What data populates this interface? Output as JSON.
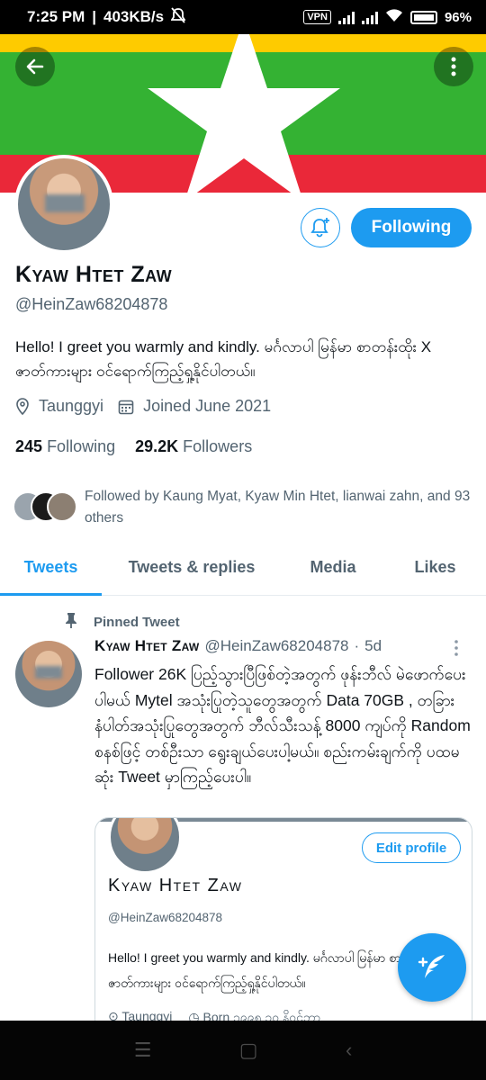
{
  "status_bar": {
    "time": "7:25 PM",
    "speed": "403KB/s",
    "vpn": "VPN",
    "battery": "96%"
  },
  "profile": {
    "name": "Kyaw Htet Zaw",
    "handle": "@HeinZaw68204878",
    "follow_button": "Following",
    "bio": "Hello! I greet you warmly and kindly.  မင်္ဂလာပါ မြန်မာ စာတန်းထိုး X ဇာတ်ကားများ ဝင်ရောက်ကြည့်ရှု့နိုင်ပါတယ်။",
    "location": "Taunggyi",
    "joined": "Joined June 2021",
    "following_count": "245",
    "following_label": "Following",
    "followers_count": "29.2K",
    "followers_label": "Followers",
    "followed_by": "Followed by Kaung Myat, Kyaw Min Htet, lianwai zahn, and 93 others"
  },
  "tabs": [
    {
      "label": "Tweets"
    },
    {
      "label": "Tweets & replies"
    },
    {
      "label": "Media"
    },
    {
      "label": "Likes"
    }
  ],
  "tweet": {
    "pinned_label": "Pinned Tweet",
    "author_name": "Kyaw Htet Zaw",
    "author_handle": "@HeinZaw68204878",
    "dot": "·",
    "time": "5d",
    "text": "Follower 26K ပြည့်သွားပြီဖြစ်တဲ့အတွက် ဖုန်းဘီလ် မဲဖောက်ပေးပါမယ် Mytel အသုံးပြုတဲ့သူတွေအတွက် Data 70GB , တခြားနံပါတ်အသုံးပြုတွေအတွက် ဘီလ်သီးသန့် 8000 ကျပ်ကို Random စနစ်ဖြင့် တစ်ဦးသာ ရွေးချယ်ပေးပါ့မယ်။ စည်းကမ်းချက်ကို ပထမဆုံး Tweet မှာကြည့်ပေးပါ။"
  },
  "quoted_card": {
    "edit_button": "Edit profile",
    "name": "Kyaw Htet Zaw",
    "handle": "@HeinZaw68204878",
    "bio": "Hello! I greet you warmly and kindly.  မင်္ဂလာပါ မြန်မာ စာတန်းထိုး X ဇာတ်ကားများ ဝင်ရောက်ကြည့်ရှု့နိုင်ပါတယ်။",
    "location": "Taunggyi",
    "born": "Born ၁၉၉၅ ၁၀ နိဝင်ဘာ"
  },
  "colors": {
    "accent": "#1d9bf0",
    "flag_yellow": "#fecb00",
    "flag_green": "#34b233",
    "flag_red": "#ea2839"
  }
}
